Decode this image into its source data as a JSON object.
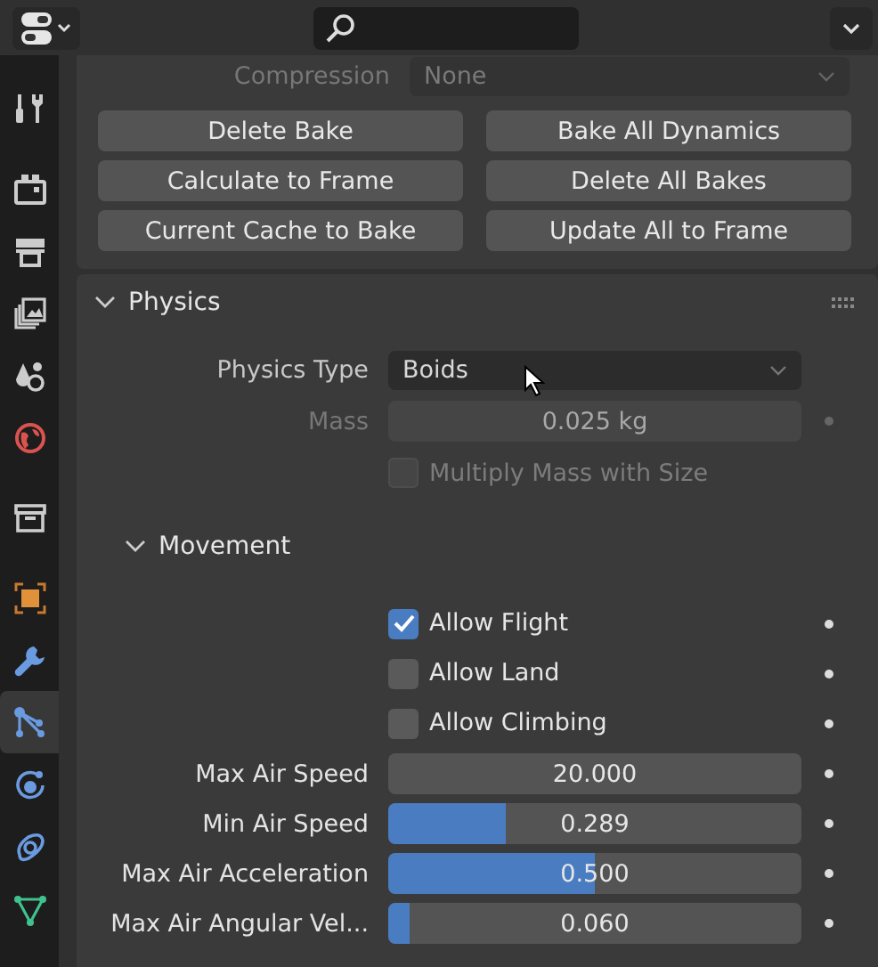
{
  "sidebar": {
    "tabs": [
      {
        "kind": "tool",
        "selected": false
      },
      {
        "kind": "render",
        "selected": false
      },
      {
        "kind": "output",
        "selected": false
      },
      {
        "kind": "view_layer",
        "selected": false
      },
      {
        "kind": "scene",
        "selected": false
      },
      {
        "kind": "world",
        "selected": false
      },
      {
        "kind": "collection",
        "selected": false
      },
      {
        "kind": "object",
        "selected": false
      },
      {
        "kind": "modifiers",
        "selected": false
      },
      {
        "kind": "particles",
        "selected": true
      },
      {
        "kind": "physics",
        "selected": false
      },
      {
        "kind": "constraints",
        "selected": false
      },
      {
        "kind": "data",
        "selected": false
      }
    ]
  },
  "cache": {
    "compression": {
      "label": "Compression",
      "value": "None",
      "disabled": true
    },
    "buttons": [
      "Delete Bake",
      "Bake All Dynamics",
      "Calculate to Frame",
      "Delete All Bakes",
      "Current Cache to Bake",
      "Update All to Frame"
    ]
  },
  "physics": {
    "title": "Physics",
    "expanded": true,
    "physics_type": {
      "label": "Physics Type",
      "value": "Boids"
    },
    "mass": {
      "label": "Mass",
      "value": "0.025 kg",
      "disabled": true
    },
    "multiply_mass": {
      "label": "Multiply Mass with Size",
      "checked": false,
      "disabled": true
    },
    "movement": {
      "title": "Movement",
      "expanded": true,
      "toggles": [
        {
          "label": "Allow Flight",
          "checked": true
        },
        {
          "label": "Allow Land",
          "checked": false
        },
        {
          "label": "Allow Climbing",
          "checked": false
        }
      ],
      "fields": [
        {
          "kind": "number",
          "label": "Max Air Speed",
          "value": "20.000"
        },
        {
          "kind": "slider",
          "label": "Min Air Speed",
          "value": "0.289",
          "level": 0.285
        },
        {
          "kind": "slider",
          "label": "Max Air Acceleration",
          "value": "0.500",
          "level": 0.5
        },
        {
          "kind": "slider",
          "label": "Max Air Angular Vel...",
          "value": "0.060",
          "level": 0.05
        }
      ]
    }
  }
}
